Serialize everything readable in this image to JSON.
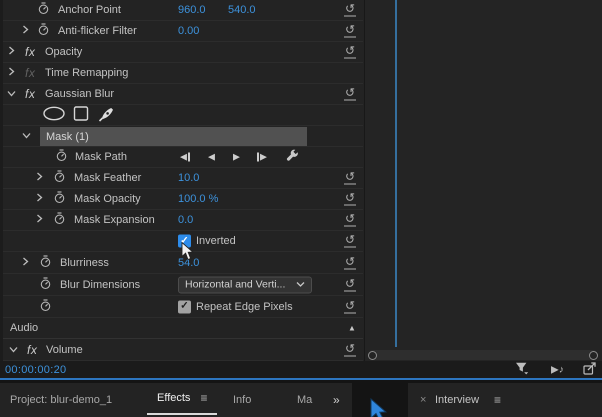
{
  "glyphs": {
    "fx": "fx",
    "reset": "↺",
    "menu": "≡",
    "close": "×",
    "overflow": "»",
    "tri_left": "◀",
    "tri_right": "▶",
    "tri_up": "▲",
    "note": "♪",
    "check": "✓"
  },
  "colors": {
    "value_blue": "#3d92dc",
    "accent_blue": "#2d8ceb",
    "panel_bg": "#232323",
    "mask_highlight": "#515151",
    "playhead_blue": "#356f9e"
  },
  "fx": {
    "anchor_point": {
      "label": "Anchor Point",
      "x": "960.0",
      "y": "540.0"
    },
    "anti_flicker": {
      "label": "Anti-flicker Filter",
      "value": "0.00"
    },
    "opacity": {
      "label": "Opacity"
    },
    "time_remapping": {
      "label": "Time Remapping"
    },
    "gaussian_blur": {
      "label": "Gaussian Blur"
    },
    "mask": {
      "label": "Mask (1)"
    },
    "mask_path": {
      "label": "Mask Path"
    },
    "mask_feather": {
      "label": "Mask Feather",
      "value": "10.0"
    },
    "mask_opacity": {
      "label": "Mask Opacity",
      "value": "100.0 %"
    },
    "mask_expansion": {
      "label": "Mask Expansion",
      "value": "0.0"
    },
    "inverted": {
      "label": "Inverted",
      "checked": true
    },
    "blurriness": {
      "label": "Blurriness",
      "value": "54.0"
    },
    "blur_dimensions": {
      "label": "Blur Dimensions",
      "selected": "Horizontal and Verti..."
    },
    "repeat_edge_pixels": {
      "label": "Repeat Edge Pixels",
      "checked": true
    },
    "audio": {
      "label": "Audio"
    },
    "volume": {
      "label": "Volume"
    }
  },
  "timecode": "00:00:00:20",
  "tabs": {
    "project": "Project: blur-demo_1",
    "effects": "Effects",
    "info": "Info",
    "markers": "Ma",
    "interview": "Interview"
  }
}
